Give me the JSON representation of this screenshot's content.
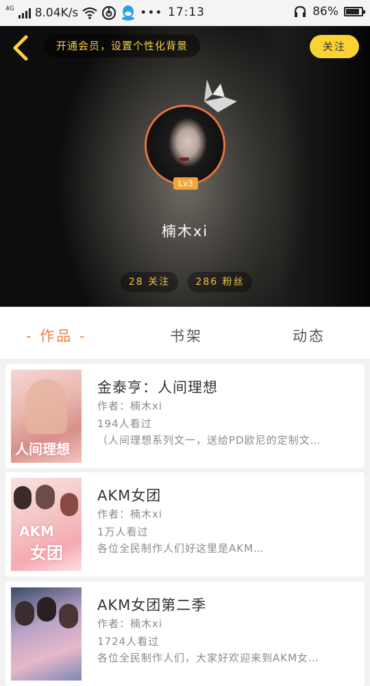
{
  "status_bar": {
    "network_label": "4G",
    "speed": "8.04K/s",
    "time": "17:13",
    "battery_percent": "86%",
    "battery_level": 0.86
  },
  "header": {
    "vip_prompt": "开通会员，设置个性化背景",
    "follow_label": "关注",
    "level_badge": "Lv3",
    "username": "楠木xi",
    "following_text": "28 关注",
    "fans_text": "286 粉丝"
  },
  "tabs": [
    {
      "label": "- 作品 -",
      "active": true
    },
    {
      "label": "书架",
      "active": false
    },
    {
      "label": "动态",
      "active": false
    }
  ],
  "books": [
    {
      "title": "金泰亨：人间理想",
      "author": "作者：楠木xi",
      "views": "194人看过",
      "desc": "（人间理想系列文一，送给PD欧尼的定制文…"
    },
    {
      "title": "AKM女团",
      "author": "作者：楠木xi",
      "views": "1万人看过",
      "desc": "各位全民制作人们好这里是AKM…"
    },
    {
      "title": "AKM女团第二季",
      "author": "作者：楠木xi",
      "views": "1724人看过",
      "desc": "各位全民制作人们，大家好欢迎来到AKM女…"
    }
  ],
  "colors": {
    "accent": "#ef7f3f",
    "follow_button": "#f9d233",
    "vip_text": "#f7d04a",
    "avatar_ring": "#e5743f"
  }
}
